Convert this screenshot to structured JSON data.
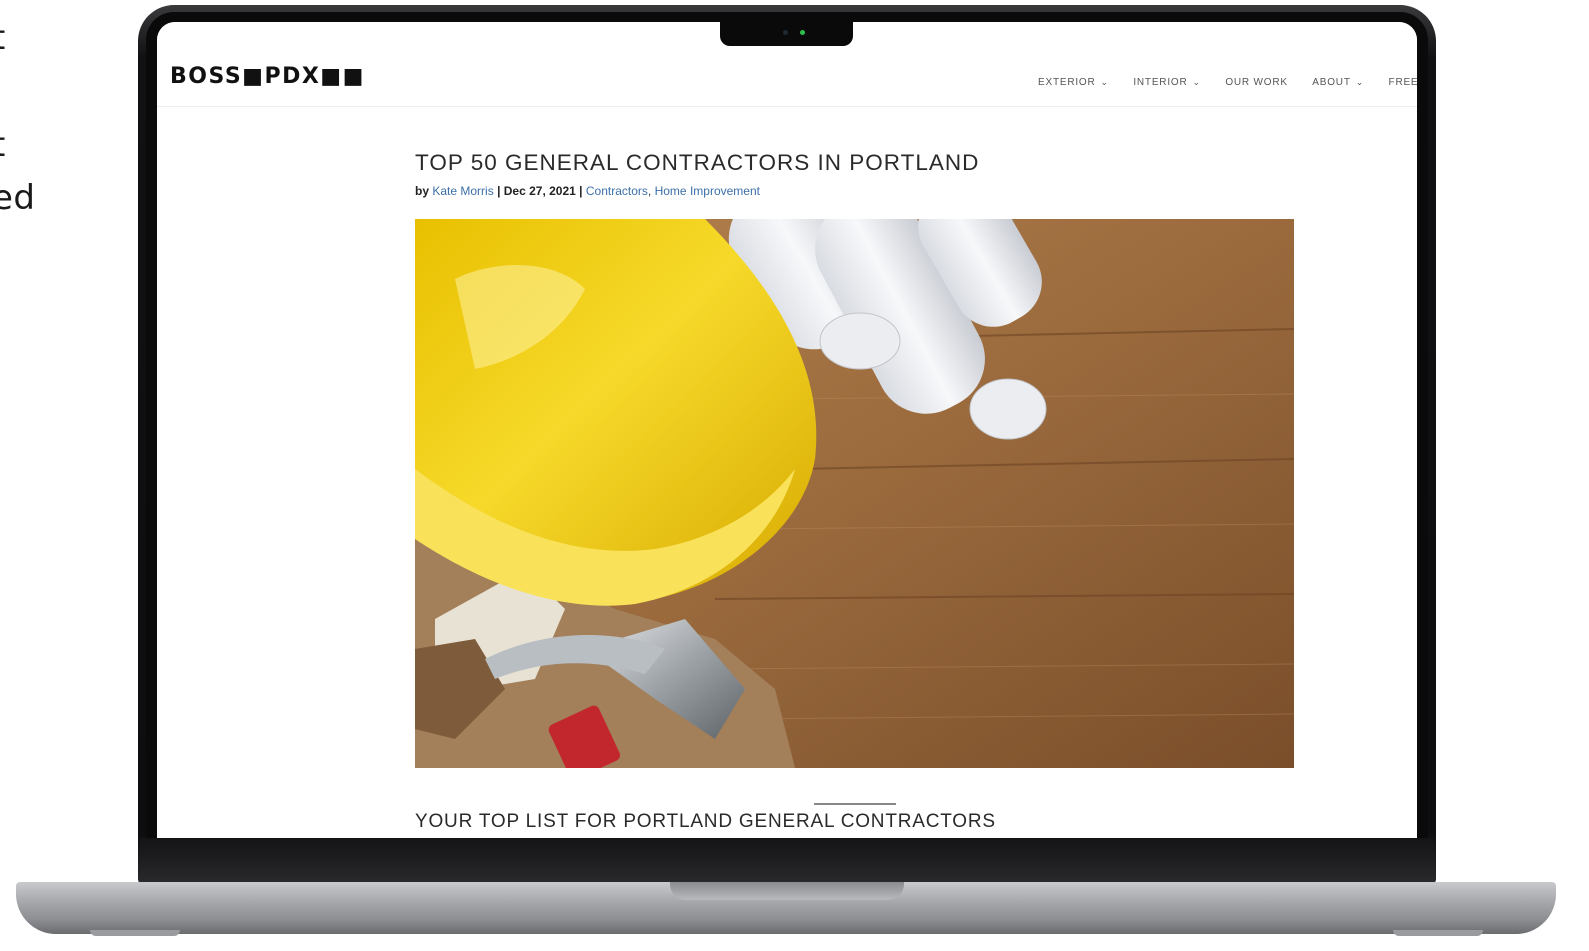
{
  "edge_text": [
    "t",
    "t",
    "ed"
  ],
  "site": {
    "logo": "BOSS■PDX■■",
    "nav": [
      {
        "label": "EXTERIOR",
        "dropdown": true
      },
      {
        "label": "INTERIOR",
        "dropdown": true
      },
      {
        "label": "OUR WORK",
        "dropdown": false
      },
      {
        "label": "ABOUT",
        "dropdown": true
      },
      {
        "label": "FREE ESTIM",
        "dropdown": false
      }
    ],
    "chevron": "⌄"
  },
  "post": {
    "title": "TOP 50 GENERAL CONTRACTORS IN PORTLAND",
    "meta": {
      "by": "by",
      "author": "Kate Morris",
      "sep1": "|",
      "date": "Dec 27, 2021",
      "sep2": "|",
      "category1": "Contractors",
      "comma": ",",
      "category2": "Home Improvement"
    },
    "hero_alt": "Yellow hard hat, blueprints, gloves and hammer on wooden table",
    "section_heading": "YOUR TOP LIST FOR PORTLAND GENERAL CONTRACTORS"
  },
  "colors": {
    "accent_link": "#3d6fa8",
    "camera_led": "#2fbf4f",
    "hardhat": "#f2cf1e",
    "wood": "#9a6a3d"
  }
}
